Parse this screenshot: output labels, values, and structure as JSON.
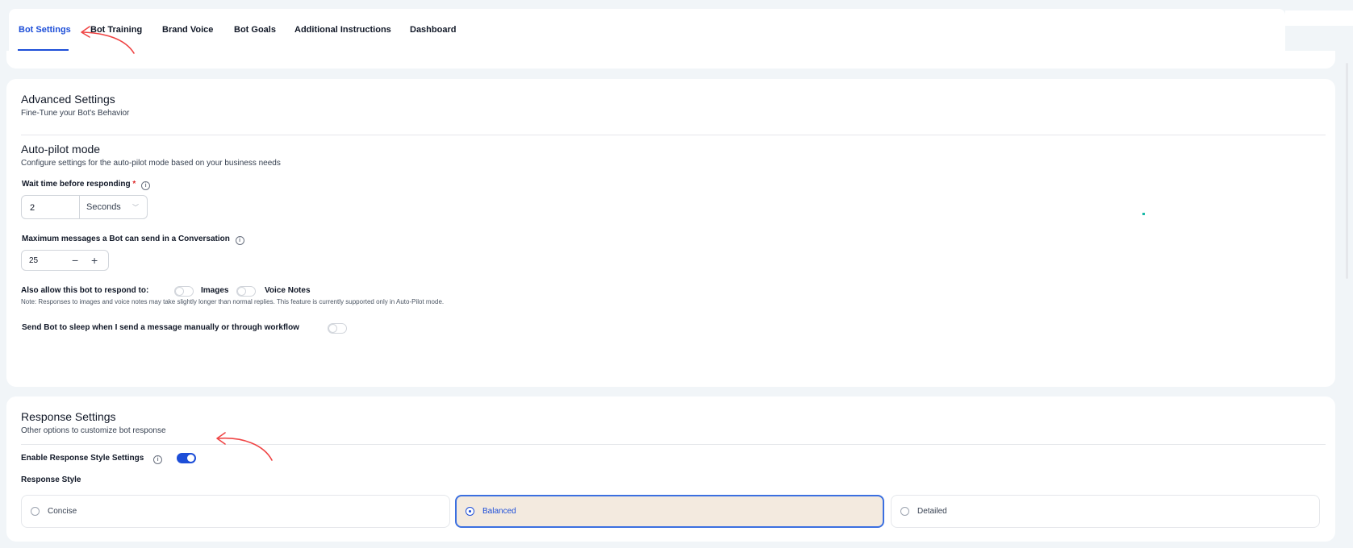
{
  "tabs": [
    {
      "label": "Bot Settings",
      "active": true
    },
    {
      "label": "Bot Training",
      "active": false
    },
    {
      "label": "Brand Voice",
      "active": false
    },
    {
      "label": "Bot Goals",
      "active": false
    },
    {
      "label": "Additional Instructions",
      "active": false
    },
    {
      "label": "Dashboard",
      "active": false
    }
  ],
  "advanced": {
    "title": "Advanced Settings",
    "subtitle": "Fine-Tune your Bot's Behavior",
    "autopilot": {
      "title": "Auto-pilot mode",
      "subtitle": "Configure settings for the auto-pilot mode based on your business needs",
      "wait_label": "Wait time before responding",
      "required_mark": "*",
      "wait_value": "2",
      "wait_unit": "Seconds",
      "max_label": "Maximum messages a Bot can send in a Conversation",
      "max_value": "25",
      "minus": "−",
      "plus": "+",
      "respond_label": "Also allow this bot to respond to:",
      "images_label": "Images",
      "images_on": false,
      "voice_label": "Voice Notes",
      "voice_on": false,
      "note": "Note: Responses to images and voice notes may take slightly longer than normal replies. This feature is currently supported only in Auto-Pilot mode.",
      "sleep_label": "Send Bot to sleep when I send a message manually or through workflow",
      "sleep_on": false
    }
  },
  "response": {
    "title": "Response Settings",
    "subtitle": "Other options to customize bot response",
    "enable_label": "Enable Response Style Settings",
    "enable_on": true,
    "style_label": "Response Style",
    "options": [
      {
        "label": "Concise",
        "selected": false
      },
      {
        "label": "Balanced",
        "selected": true
      },
      {
        "label": "Detailed",
        "selected": false
      }
    ]
  },
  "colors": {
    "accent": "#1d4ed8",
    "annotation": "#ef4444",
    "selected_bg": "#f3eadf"
  },
  "icons": {
    "info": "info-icon",
    "chevron": "chevron-down-icon",
    "annotation": "red-arrow-annotation"
  }
}
